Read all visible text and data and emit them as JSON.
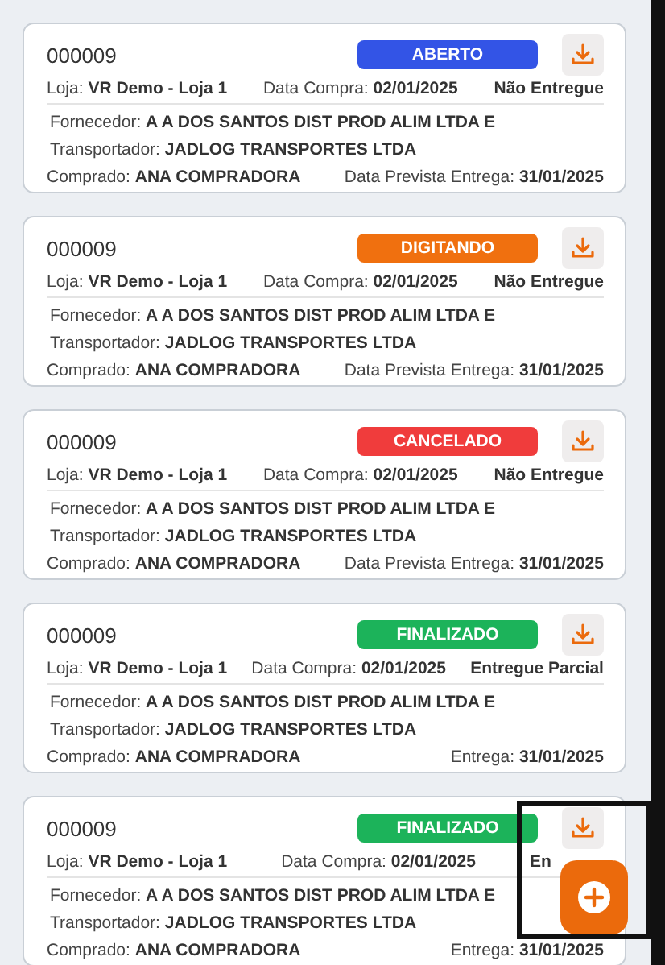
{
  "orders": [
    {
      "code": "000009",
      "status": {
        "label": "ABERTO",
        "color": "#3354e6"
      },
      "store": "Loja: **VR Demo - Loja 1**",
      "purchase_date": "Data Compra: **02/01/2025**",
      "delivery": "Não Entregue",
      "supplier": "Fornecedor: **A A DOS SANTOS DIST PROD ALIM LTDA E**",
      "carrier": "Transportador: **JADLOG TRANSPORTES LTDA**",
      "buyer": "Comprado: **ANA COMPRADORA**",
      "date": "Data Prevista Entrega: **31/01/2025**"
    },
    {
      "code": "000009",
      "status": {
        "label": "DIGITANDO",
        "color": "#f0700f"
      },
      "store": "Loja: **VR Demo - Loja 1**",
      "purchase_date": "Data Compra: **02/01/2025**",
      "delivery": "Não Entregue",
      "supplier": "Fornecedor: **A A DOS SANTOS DIST PROD ALIM LTDA E**",
      "carrier": "Transportador: **JADLOG TRANSPORTES LTDA**",
      "buyer": "Comprado: **ANA COMPRADORA**",
      "date": "Data Prevista Entrega: **31/01/2025**"
    },
    {
      "code": "000009",
      "status": {
        "label": "CANCELADO",
        "color": "#f03c3c"
      },
      "store": "Loja: **VR Demo - Loja 1**",
      "purchase_date": "Data Compra: **02/01/2025**",
      "delivery": "Não Entregue",
      "supplier": "Fornecedor: **A A DOS SANTOS DIST PROD ALIM LTDA E**",
      "carrier": "Transportador: **JADLOG TRANSPORTES LTDA**",
      "buyer": "Comprado: **ANA COMPRADORA**",
      "date": "Data Prevista Entrega: **31/01/2025**"
    },
    {
      "code": "000009",
      "status": {
        "label": "FINALIZADO",
        "color": "#1cb35a"
      },
      "store": "Loja: **VR Demo - Loja 1**",
      "purchase_date": "Data Compra: **02/01/2025**",
      "delivery": "Entregue Parcial",
      "supplier": "Fornecedor: **A A DOS SANTOS DIST PROD ALIM LTDA E**",
      "carrier": "Transportador: **JADLOG TRANSPORTES LTDA**",
      "buyer": "Comprado: **ANA COMPRADORA**",
      "date": "Entrega: **31/01/2025**"
    },
    {
      "code": "000009",
      "status": {
        "label": "FINALIZADO",
        "color": "#1cb35a"
      },
      "store": "Loja: **VR Demo - Loja 1**",
      "purchase_date": "Data Compra: **02/01/2025**",
      "delivery": "En",
      "supplier": "Fornecedor: **A A DOS SANTOS DIST PROD ALIM LTDA E**",
      "carrier": "Transportador: **JADLOG TRANSPORTES LTDA**",
      "buyer": "Comprado: **ANA COMPRADORA**",
      "date": "Entrega: **31/01/2025**"
    }
  ]
}
